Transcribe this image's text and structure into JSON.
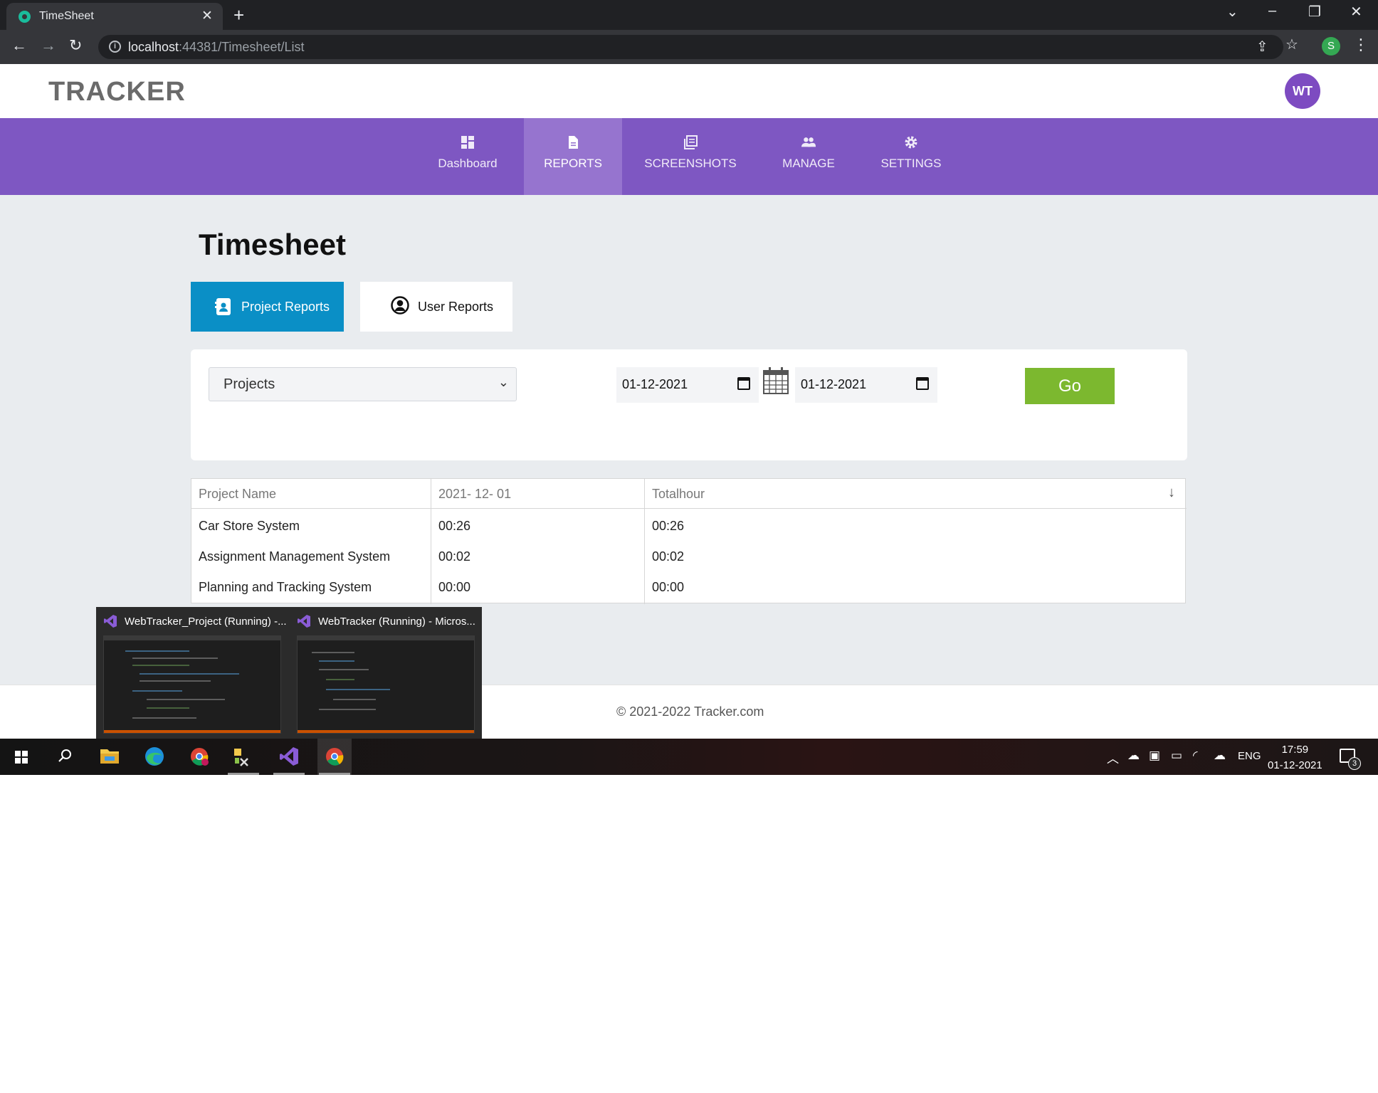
{
  "browser": {
    "tab_title": "TimeSheet",
    "tab_close": "✕",
    "new_tab": "+",
    "url_host": "localhost",
    "url_path": ":44381/Timesheet/List",
    "profile_initial": "S",
    "icons": [
      "back-arrow-icon",
      "forward-arrow-icon",
      "reload-icon",
      "info-icon",
      "share-icon",
      "star-icon",
      "kebab-menu-icon"
    ]
  },
  "site": {
    "logo": "TRACKER",
    "avatar": "WT",
    "nav": [
      {
        "label": "Dashboard",
        "icon": "dashboard-icon"
      },
      {
        "label": "REPORTS",
        "icon": "document-icon",
        "active": true
      },
      {
        "label": "SCREENSHOTS",
        "icon": "gallery-icon"
      },
      {
        "label": "MANAGE",
        "icon": "people-icon"
      },
      {
        "label": "SETTINGS",
        "icon": "gear-icon"
      }
    ],
    "accent_color": "#7e57c2"
  },
  "page": {
    "title": "Timesheet",
    "tabs": {
      "project": "Project Reports",
      "user": "User Reports"
    },
    "filter": {
      "project_select": "Projects",
      "start_date": "01-12-2021",
      "end_date": "01-12-2021",
      "go_label": "Go"
    },
    "table": {
      "headers": [
        "Project Name",
        "2021- 12- 01",
        "Totalhour"
      ],
      "rows": [
        [
          "Car Store System",
          "00:26",
          "00:26"
        ],
        [
          "Assignment Management System",
          "00:02",
          "00:02"
        ],
        [
          "Planning and Tracking System",
          "00:00",
          "00:00"
        ]
      ]
    },
    "footer": "© 2021-2022 Tracker.com"
  },
  "taskbar_preview": {
    "windows": [
      "WebTracker_Project (Running) -...",
      "WebTracker (Running) - Micros..."
    ]
  },
  "taskbar": {
    "language": "ENG",
    "time": "17:59",
    "date": "01-12-2021",
    "notification_count": "3"
  }
}
